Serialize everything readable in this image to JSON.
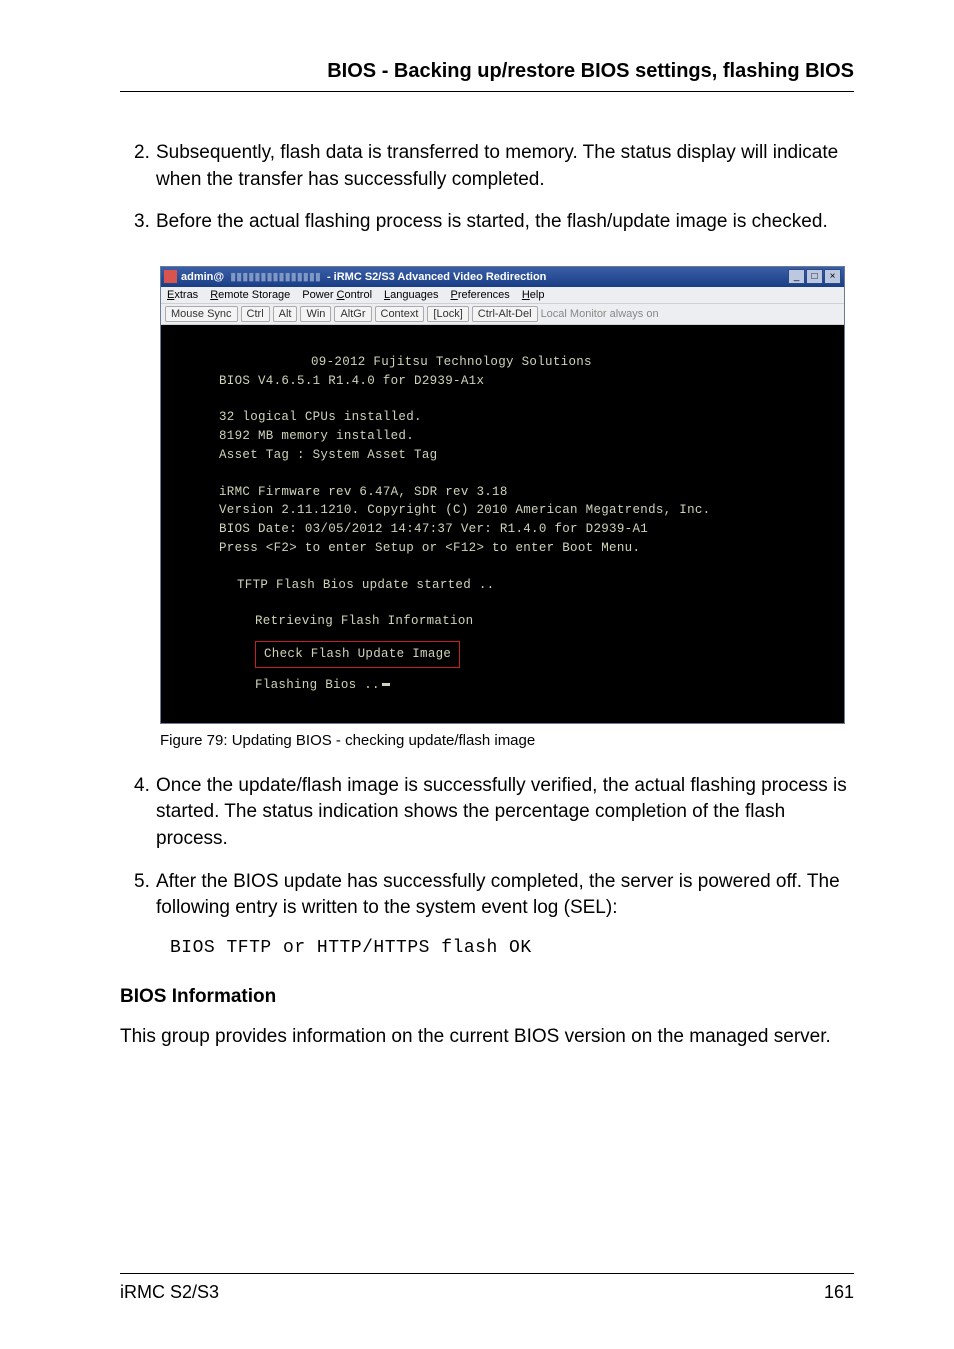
{
  "header": "BIOS - Backing up/restore BIOS settings, flashing BIOS",
  "steps": {
    "s2_num": "2.",
    "s2": "Subsequently, flash data is transferred to memory. The status display will indicate when the transfer has successfully completed.",
    "s3_num": "3.",
    "s3": "Before the actual flashing process is started, the flash/update image is checked.",
    "s4_num": "4.",
    "s4": "Once the update/flash image is successfully verified, the actual flashing process is started. The status indication shows the percentage completion of the flash process.",
    "s5_num": "5.",
    "s5": "After the BIOS update has successfully completed, the server is powered off. The following entry is written to the system event log (SEL):"
  },
  "window": {
    "title_user": "admin@",
    "title_addr": "▮▮▮▮▮▮▮▮▮▮▮▮▮▮▮",
    "title_main": "- iRMC S2/S3 Advanced Video Redirection",
    "menu": {
      "extras": "Extras",
      "remote": "Remote Storage",
      "power": "Power Control",
      "lang": "Languages",
      "pref": "Preferences",
      "help": "Help"
    },
    "toolbar": {
      "mouse": "Mouse Sync",
      "ctrl": "Ctrl",
      "alt": "Alt",
      "win": "Win",
      "altgr": "AltGr",
      "context": "Context",
      "lock": "[Lock]",
      "cad": "Ctrl-Alt-Del",
      "monitor": "Local Monitor always on"
    }
  },
  "terminal": {
    "l1": "09-2012 Fujitsu Technology Solutions",
    "l2": "BIOS V4.6.5.1 R1.4.0 for D2939-A1x",
    "l3": "32 logical CPUs installed.",
    "l4": "8192 MB memory installed.",
    "l5": "Asset Tag : System Asset Tag",
    "l6": "iRMC Firmware rev 6.47A, SDR rev 3.18",
    "l7": "Version 2.11.1210. Copyright (C) 2010 American Megatrends, Inc.",
    "l8": "BIOS Date: 03/05/2012 14:47:37 Ver: R1.4.0 for D2939-A1",
    "l9": "Press <F2> to enter Setup or <F12> to enter Boot Menu.",
    "l10": "TFTP Flash Bios update started ..",
    "l11": "Retrieving Flash Information",
    "l12": "Check Flash Update Image",
    "l13": "Flashing Bios .."
  },
  "figure_caption": "Figure 79: Updating BIOS - checking update/flash image",
  "code_line": "BIOS TFTP or HTTP/HTTPS flash OK",
  "section_title": "BIOS Information",
  "section_para": "This group provides information on the current BIOS version on the managed server.",
  "footer_left": "iRMC S2/S3",
  "footer_right": "161"
}
